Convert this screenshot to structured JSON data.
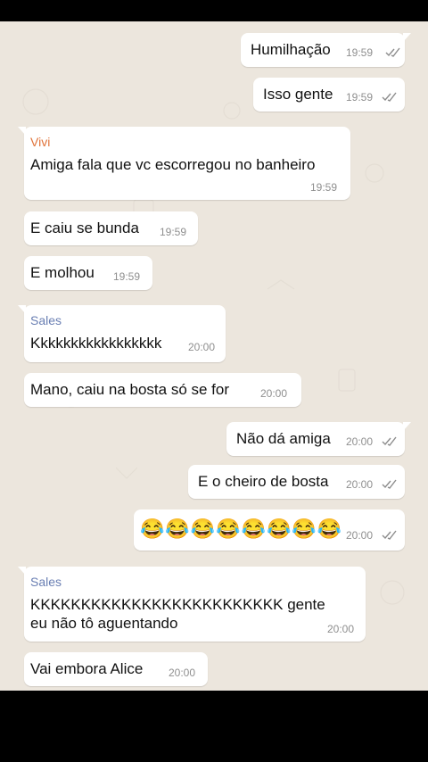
{
  "colors": {
    "chat_background": "#ece6dd",
    "bubble": "#ffffff",
    "vivi_name": "#e0733a",
    "sales_name": "#6a7fb3",
    "tick": "#8c8c8c"
  },
  "messages": [
    {
      "dir": "out",
      "text": "Humilhação",
      "time": "19:59",
      "ticks": "double-check-icon"
    },
    {
      "dir": "out",
      "text": "Isso gente",
      "time": "19:59",
      "ticks": "double-check-icon"
    },
    {
      "dir": "in",
      "sender": "Vivi",
      "text": "Amiga fala que vc escorregou no banheiro",
      "time": "19:59"
    },
    {
      "dir": "in",
      "text": "E caiu se bunda",
      "time": "19:59"
    },
    {
      "dir": "in",
      "text": "E molhou",
      "time": "19:59"
    },
    {
      "dir": "in",
      "sender": "Sales",
      "text": "Kkkkkkkkkkkkkkkkk",
      "time": "20:00"
    },
    {
      "dir": "in",
      "text": "Mano, caiu na bosta só se for",
      "time": "20:00"
    },
    {
      "dir": "out",
      "text": "Não dá amiga",
      "time": "20:00",
      "ticks": "double-check-icon"
    },
    {
      "dir": "out",
      "text": "E o cheiro de bosta",
      "time": "20:00",
      "ticks": "double-check-icon"
    },
    {
      "dir": "out",
      "text": "😂😂😂😂😂😂😂😂",
      "time": "20:00",
      "ticks": "double-check-icon"
    },
    {
      "dir": "in",
      "sender": "Sales",
      "text_line1": "KKKKKKKKKKKKKKKKKKKKKKKKK gente",
      "text_line2": "eu não tô aguentando",
      "time": "20:00"
    },
    {
      "dir": "in",
      "text": "Vai embora Alice",
      "time": "20:00"
    }
  ]
}
